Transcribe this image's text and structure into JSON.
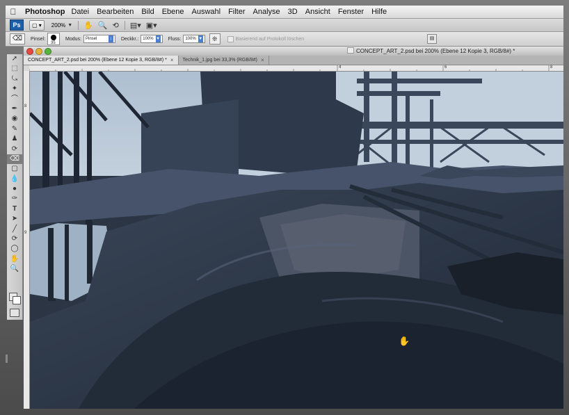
{
  "menubar": {
    "apple_icon": "apple-icon",
    "app_name": "Photoshop",
    "items": [
      "Datei",
      "Bearbeiten",
      "Bild",
      "Ebene",
      "Auswahl",
      "Filter",
      "Analyse",
      "3D",
      "Ansicht",
      "Fenster",
      "Hilfe"
    ]
  },
  "appbar": {
    "logo": "Ps",
    "zoom": "200%"
  },
  "options": {
    "brush_label": "Pinsel:",
    "brush_size": "35",
    "mode_label": "Modus:",
    "mode_value": "Pinsel",
    "opacity_label": "Deckkr.:",
    "opacity_value": "100%",
    "flow_label": "Fluss:",
    "flow_value": "100%",
    "history_label": "Basierend auf Protokoll löschen"
  },
  "document": {
    "title": "CONCEPT_ART_2.psd bei 200% (Ebene 12 Kopie 3, RGB/8#) *",
    "tabs": [
      {
        "label": "CONCEPT_ART_2.psd bei 200% (Ebene 12 Kopie 3, RGB/8#) *",
        "active": true
      },
      {
        "label": "Technik_1.jpg bei 33,3% (RGB/8#)",
        "active": false
      }
    ],
    "ruler_h": [
      "4",
      "6",
      "8"
    ],
    "ruler_v": [
      "8",
      "9"
    ]
  },
  "colors": {
    "sky": "#b4c3d3",
    "scene_dark": "#2c3645",
    "scene_mid": "#46536a"
  }
}
